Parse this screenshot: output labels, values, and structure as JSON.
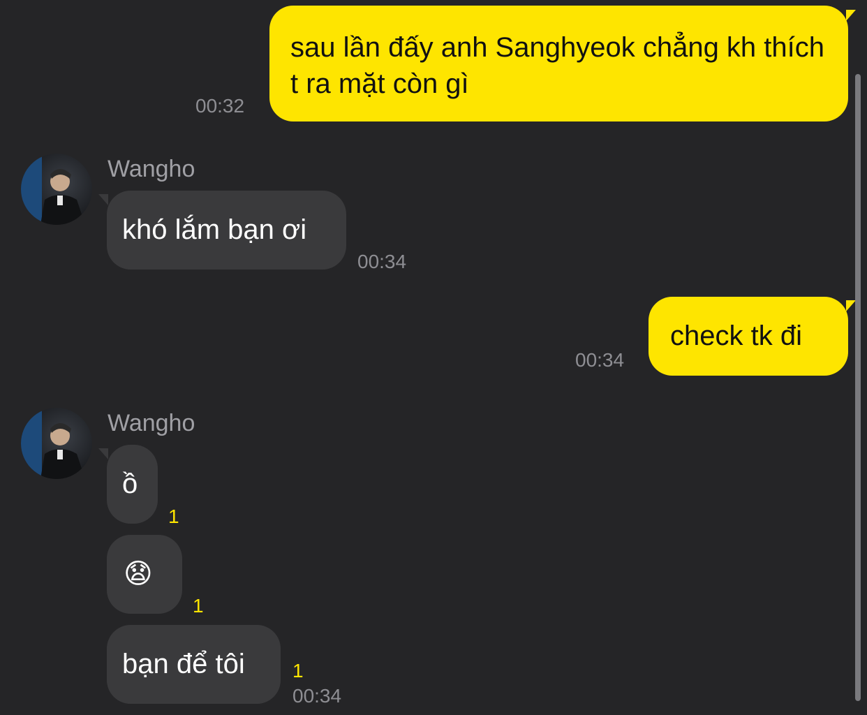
{
  "messages": {
    "m1": {
      "text": "sau lần đấy anh Sanghyeok chẳng kh thích t ra mặt còn gì",
      "time": "00:32"
    },
    "m2": {
      "sender": "Wangho",
      "text": "khó lắm bạn ơi",
      "time": "00:34"
    },
    "m3": {
      "text": "check tk đi",
      "time": "00:34"
    },
    "m4": {
      "sender": "Wangho",
      "text": "ồ",
      "unread": "1"
    },
    "m5": {
      "text": "😧",
      "unread": "1"
    },
    "m6": {
      "text": "bạn để tôi",
      "unread": "1",
      "time": "00:34"
    }
  },
  "colors": {
    "background": "#252527",
    "outgoing_bubble": "#fee500",
    "incoming_bubble": "#3a3a3c",
    "unread_count": "#fee500"
  },
  "icons": {
    "avatar": "profile-photo-avatar-icon"
  }
}
